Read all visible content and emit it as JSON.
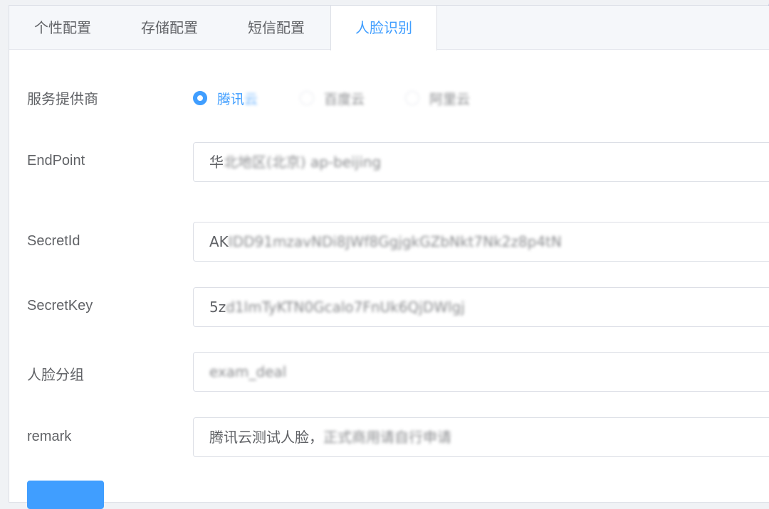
{
  "tabs": [
    {
      "label": "个性配置",
      "active": false
    },
    {
      "label": "存储配置",
      "active": false
    },
    {
      "label": "短信配置",
      "active": false
    },
    {
      "label": "人脸识别",
      "active": true
    }
  ],
  "form": {
    "provider": {
      "label": "服务提供商",
      "options": [
        {
          "label": "腾讯云",
          "checked": true
        },
        {
          "label": "百度云",
          "checked": false
        },
        {
          "label": "阿里云",
          "checked": false
        }
      ]
    },
    "endpoint": {
      "label": "EndPoint",
      "value": "华北地区(北京) ap-beijing"
    },
    "secret_id": {
      "label": "SecretId",
      "value": "AKIDD91mzavNDi8JWf8GgjgkGZbNkt7Nk2z8p4tN"
    },
    "secret_key": {
      "label": "SecretKey",
      "value": "5zd1lmTyKTN0Gcalo7FnUk6QjDWlgj"
    },
    "face_group": {
      "label": "人脸分组",
      "value": "exam_deal"
    },
    "remark": {
      "label": "remark",
      "value": "腾讯云测试人脸，正式商用请自行申请"
    }
  },
  "colors": {
    "accent": "#409eff",
    "border": "#dcdfe6",
    "text": "#606266"
  }
}
